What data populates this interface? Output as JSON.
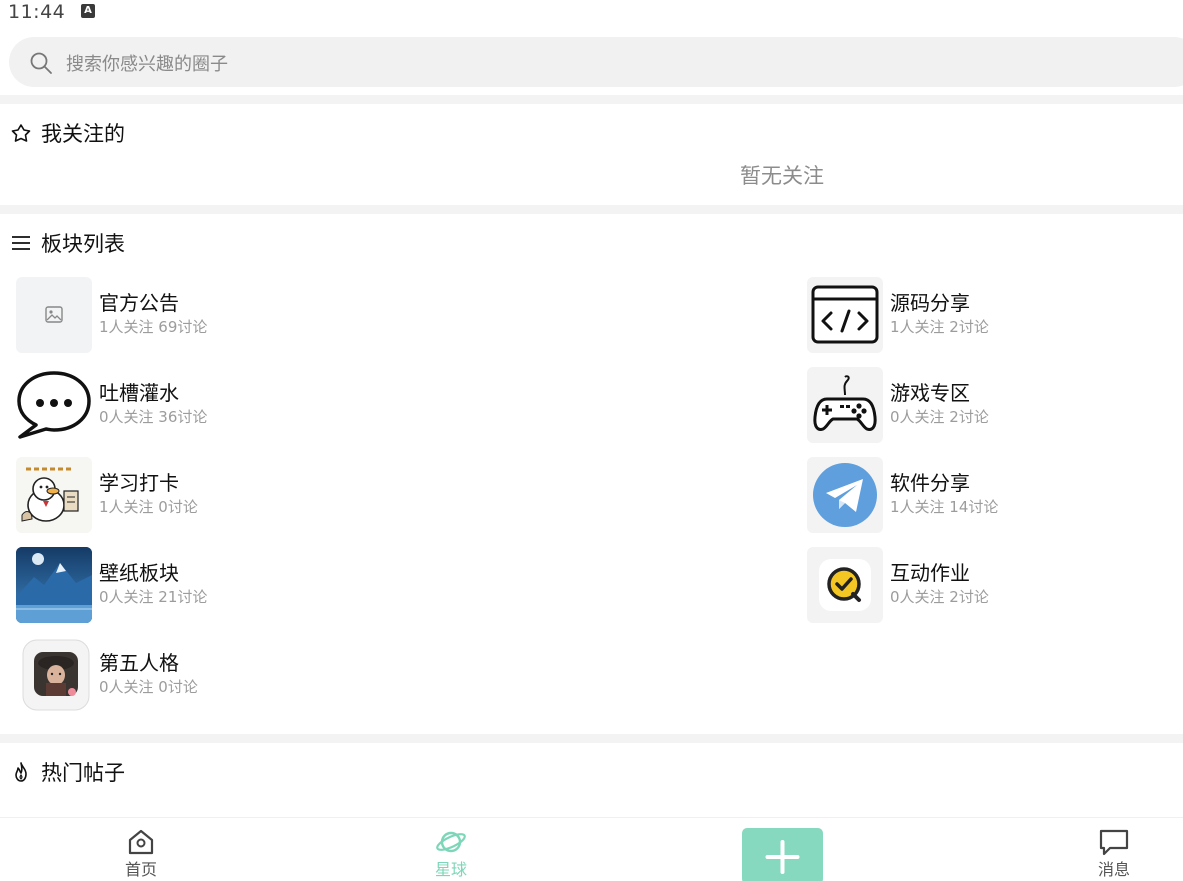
{
  "status_bar": {
    "time": "11:44",
    "indicator": "A"
  },
  "search": {
    "placeholder": "搜索你感兴趣的圈子"
  },
  "following": {
    "title": "我关注的",
    "empty_text": "暂无关注"
  },
  "boards": {
    "title": "板块列表",
    "items": [
      {
        "name": "官方公告",
        "meta": "1人关注 69讨论",
        "icon": "image-placeholder-icon"
      },
      {
        "name": "源码分享",
        "meta": "1人关注 2讨论",
        "icon": "code-window-icon"
      },
      {
        "name": "吐槽灌水",
        "meta": "0人关注 36讨论",
        "icon": "speech-bubble-icon"
      },
      {
        "name": "游戏专区",
        "meta": "0人关注 2讨论",
        "icon": "gamepad-icon"
      },
      {
        "name": "学习打卡",
        "meta": "1人关注 0讨论",
        "icon": "duck-study-icon"
      },
      {
        "name": "软件分享",
        "meta": "1人关注 14讨论",
        "icon": "paper-plane-icon"
      },
      {
        "name": "壁纸板块",
        "meta": "0人关注 21讨论",
        "icon": "mountain-wallpaper-icon"
      },
      {
        "name": "互动作业",
        "meta": "0人关注 2讨论",
        "icon": "check-badge-icon"
      },
      {
        "name": "第五人格",
        "meta": "0人关注 0讨论",
        "icon": "game-character-icon"
      }
    ]
  },
  "hot_posts": {
    "title": "热门帖子"
  },
  "nav": {
    "home": "首页",
    "planet": "星球",
    "messages": "消息"
  },
  "colors": {
    "accent": "#86d9be",
    "active_label": "#7dd6b9"
  }
}
